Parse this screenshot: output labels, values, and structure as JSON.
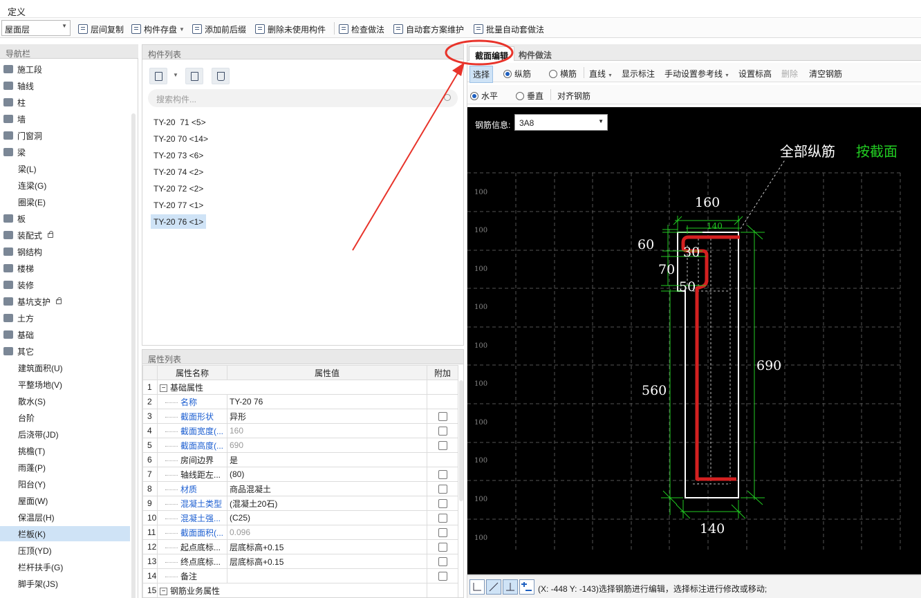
{
  "menu": {
    "define": "定义"
  },
  "toolbar": {
    "floor": "屋面层",
    "copy_between_floors": "层间复制",
    "component_save": "构件存盘",
    "add_prefix_suffix": "添加前后缀",
    "delete_unused": "删除未使用构件",
    "check_method": "检查做法",
    "auto_plan_maintain": "自动套方案维护",
    "batch_auto_method": "批量自动套做法"
  },
  "nav": {
    "title": "导航栏",
    "items": [
      {
        "label": "施工段",
        "type": "cat"
      },
      {
        "label": "轴线",
        "type": "cat"
      },
      {
        "label": "柱",
        "type": "cat"
      },
      {
        "label": "墙",
        "type": "cat"
      },
      {
        "label": "门窗洞",
        "type": "cat"
      },
      {
        "label": "梁",
        "type": "cat"
      },
      {
        "label": "梁(L)",
        "type": "sub"
      },
      {
        "label": "连梁(G)",
        "type": "sub"
      },
      {
        "label": "圈梁(E)",
        "type": "sub"
      },
      {
        "label": "板",
        "type": "cat"
      },
      {
        "label": "装配式",
        "type": "cat",
        "lock": true
      },
      {
        "label": "钢结构",
        "type": "cat"
      },
      {
        "label": "楼梯",
        "type": "cat"
      },
      {
        "label": "装修",
        "type": "cat"
      },
      {
        "label": "基坑支护",
        "type": "cat",
        "lock": true
      },
      {
        "label": "土方",
        "type": "cat"
      },
      {
        "label": "基础",
        "type": "cat"
      },
      {
        "label": "其它",
        "type": "cat"
      },
      {
        "label": "建筑面积(U)",
        "type": "sub"
      },
      {
        "label": "平整场地(V)",
        "type": "sub"
      },
      {
        "label": "散水(S)",
        "type": "sub"
      },
      {
        "label": "台阶",
        "type": "sub"
      },
      {
        "label": "后浇带(JD)",
        "type": "sub"
      },
      {
        "label": "挑檐(T)",
        "type": "sub"
      },
      {
        "label": "雨蓬(P)",
        "type": "sub"
      },
      {
        "label": "阳台(Y)",
        "type": "sub"
      },
      {
        "label": "屋面(W)",
        "type": "sub"
      },
      {
        "label": "保温层(H)",
        "type": "sub"
      },
      {
        "label": "栏板(K)",
        "type": "sub",
        "selected": true
      },
      {
        "label": "压顶(YD)",
        "type": "sub"
      },
      {
        "label": "栏杆扶手(G)",
        "type": "sub"
      },
      {
        "label": "脚手架(JS)",
        "type": "sub"
      }
    ]
  },
  "components": {
    "title": "构件列表",
    "search_placeholder": "搜索构件...",
    "items": [
      {
        "label": "TY-20  71 <5>"
      },
      {
        "label": "TY-20 70 <14>"
      },
      {
        "label": "TY-20 73 <6>"
      },
      {
        "label": "TY-20 74 <2>"
      },
      {
        "label": "TY-20 72 <2>"
      },
      {
        "label": "TY-20 77 <1>"
      },
      {
        "label": "TY-20 76 <1>",
        "selected": true
      }
    ]
  },
  "properties": {
    "title": "属性列表",
    "col_name": "属性名称",
    "col_value": "属性值",
    "col_extra": "附加",
    "rows": [
      {
        "n": "1",
        "name": "基础属性",
        "value": "",
        "group": true
      },
      {
        "n": "2",
        "name": "名称",
        "value": "TY-20 76",
        "blue": true,
        "check": false
      },
      {
        "n": "3",
        "name": "截面形状",
        "value": "异形",
        "blue": true,
        "check": true
      },
      {
        "n": "4",
        "name": "截面宽度(...",
        "value": "160",
        "blue": true,
        "gray": true,
        "check": true
      },
      {
        "n": "5",
        "name": "截面高度(...",
        "value": "690",
        "blue": true,
        "gray": true,
        "check": true
      },
      {
        "n": "6",
        "name": "房间边界",
        "value": "是",
        "check": false
      },
      {
        "n": "7",
        "name": "轴线距左...",
        "value": "(80)",
        "check": true
      },
      {
        "n": "8",
        "name": "材质",
        "value": "商品混凝土",
        "blue": true,
        "check": true
      },
      {
        "n": "9",
        "name": "混凝土类型",
        "value": "(混凝土20石)",
        "blue": true,
        "check": true
      },
      {
        "n": "10",
        "name": "混凝土强...",
        "value": "(C25)",
        "blue": true,
        "check": true
      },
      {
        "n": "11",
        "name": "截面面积(...",
        "value": "0.096",
        "blue": true,
        "gray": true,
        "check": true
      },
      {
        "n": "12",
        "name": "起点底标...",
        "value": "层底标高+0.15",
        "check": true
      },
      {
        "n": "13",
        "name": "终点底标...",
        "value": "层底标高+0.15",
        "check": true
      },
      {
        "n": "14",
        "name": "备注",
        "value": "",
        "check": true
      },
      {
        "n": "15",
        "name": "钢筋业务属性",
        "value": "",
        "group": true
      }
    ]
  },
  "editor": {
    "tab_section_edit": "截面编辑",
    "tab_component_method": "构件做法",
    "btn_select": "选择",
    "radio_longitudinal": "纵筋",
    "radio_transverse": "横筋",
    "btn_line": "直线",
    "btn_show_dim": "显示标注",
    "btn_manual_ref": "手动设置参考线",
    "btn_set_elev": "设置标高",
    "btn_delete": "删除",
    "btn_clear_rebar": "清空钢筋",
    "radio_horizontal": "水平",
    "radio_vertical": "垂直",
    "btn_align_rebar": "对齐钢筋",
    "rebar_info_label": "钢筋信息:",
    "rebar_info_value": "3A8",
    "drawing": {
      "label_all_long": "全部纵筋",
      "label_by_section": "按截面",
      "grid_label": "100",
      "dim_top_outer": "160",
      "dim_top_inner": "140",
      "dim_60": "60",
      "dim_30": "30",
      "dim_70": "70",
      "dim_50": "50",
      "dim_690": "690",
      "dim_560": "560",
      "dim_bottom": "140"
    },
    "status_text": "(X: -448 Y: -143)选择钢筋进行编辑，选择标注进行修改或移动;"
  },
  "colors": {
    "canvas_bg": "#000000",
    "rebar": "#d42020",
    "dimension": "#22cc22",
    "label_green": "#22cc22",
    "annotation": "#e8332a",
    "selection": "#cfe3f6"
  }
}
